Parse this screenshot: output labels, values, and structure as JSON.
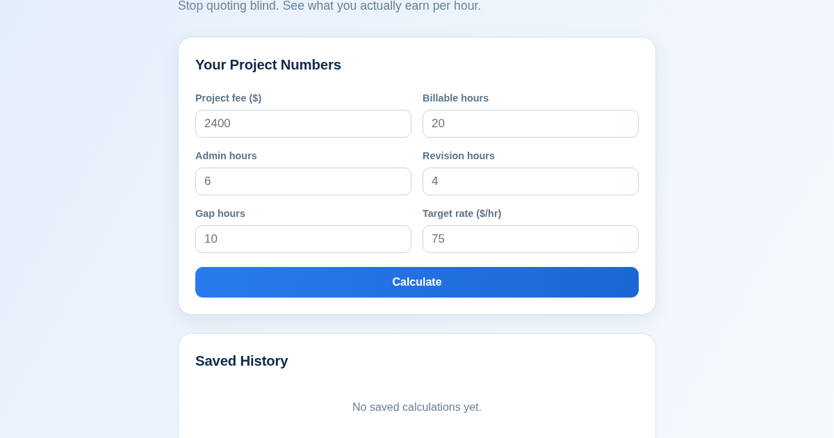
{
  "subtitle": "Stop quoting blind. See what you actually earn per hour.",
  "project_card": {
    "title": "Your Project Numbers",
    "fields": [
      {
        "label": "Project fee ($)",
        "placeholder": "2400"
      },
      {
        "label": "Billable hours",
        "placeholder": "20"
      },
      {
        "label": "Admin hours",
        "placeholder": "6"
      },
      {
        "label": "Revision hours",
        "placeholder": "4"
      },
      {
        "label": "Gap hours",
        "placeholder": "10"
      },
      {
        "label": "Target rate ($/hr)",
        "placeholder": "75"
      }
    ],
    "button": "Calculate"
  },
  "history_card": {
    "title": "Saved History",
    "empty_message": "No saved calculations yet."
  }
}
